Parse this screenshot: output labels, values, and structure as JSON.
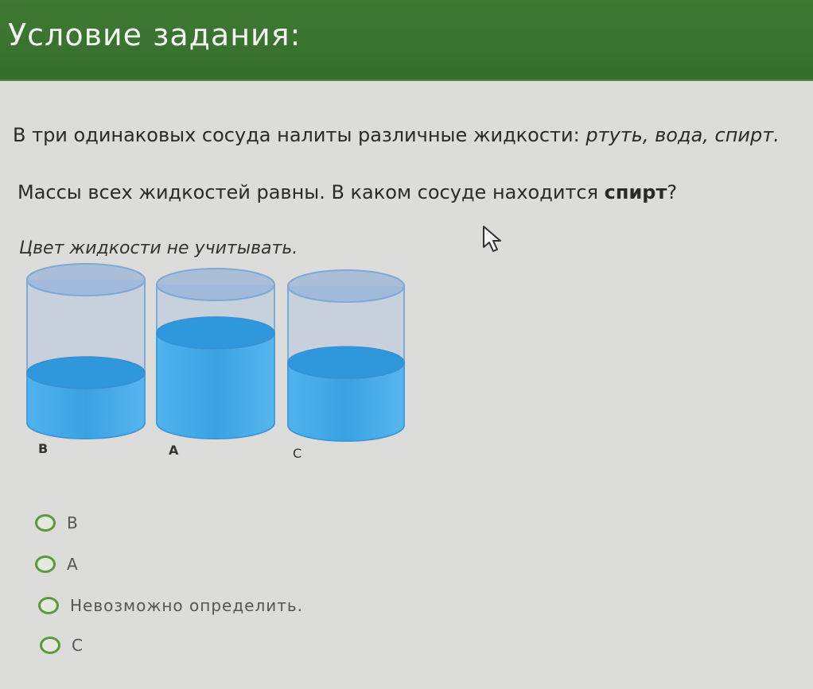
{
  "header": {
    "title": "Условие задания:"
  },
  "question": {
    "line1_prefix": "В три одинаковых сосуда налиты различные жидкости: ",
    "line1_liquids": "ртуть, вода, спирт.",
    "line2_prefix": "Массы всех жидкостей равны. В каком сосуде находится ",
    "line2_bold": "спирт",
    "line2_suffix": "?",
    "note": "Цвет жидкости не учитывать."
  },
  "vessels": [
    {
      "label": "B",
      "fill_level": 0.35
    },
    {
      "label": "A",
      "fill_level": 0.65
    },
    {
      "label": "C",
      "fill_level": 0.45
    }
  ],
  "answers": [
    {
      "label": "B",
      "selected": false
    },
    {
      "label": "A",
      "selected": false
    },
    {
      "label": "Невозможно определить.",
      "selected": false
    },
    {
      "label": "C",
      "selected": false
    }
  ],
  "colors": {
    "header": "#3f7a34",
    "liquid": "#3fa6e4",
    "radio_border": "#5a9a3c"
  },
  "icons": {
    "cursor": "mouse-pointer-icon"
  }
}
